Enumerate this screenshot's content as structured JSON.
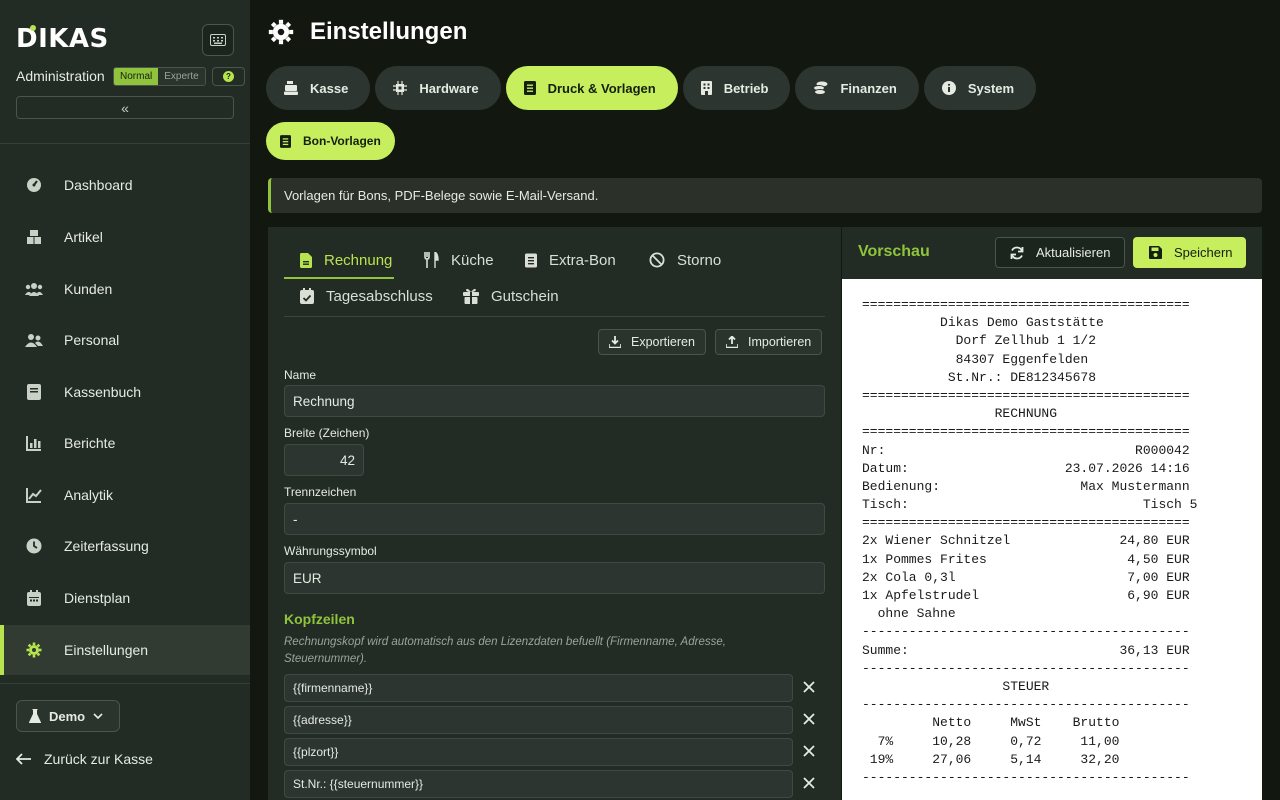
{
  "sidebar": {
    "logo": "DIKAS",
    "admin_label": "Administration",
    "mode_normal": "Normal",
    "mode_expert": "Experte",
    "help": "?",
    "collapse": "«",
    "nav": [
      {
        "label": "Dashboard",
        "icon": "gauge-icon"
      },
      {
        "label": "Artikel",
        "icon": "boxes-icon"
      },
      {
        "label": "Kunden",
        "icon": "users-icon"
      },
      {
        "label": "Personal",
        "icon": "user-group-icon"
      },
      {
        "label": "Kassenbuch",
        "icon": "book-icon"
      },
      {
        "label": "Berichte",
        "icon": "bar-chart-icon"
      },
      {
        "label": "Analytik",
        "icon": "line-chart-icon"
      },
      {
        "label": "Zeiterfassung",
        "icon": "clock-icon"
      },
      {
        "label": "Dienstplan",
        "icon": "calendar-icon"
      },
      {
        "label": "Einstellungen",
        "icon": "gear-icon"
      }
    ],
    "demo_label": "Demo",
    "back_label": "Zurück zur Kasse"
  },
  "header": {
    "title": "Einstellungen",
    "tabs": [
      {
        "label": "Kasse"
      },
      {
        "label": "Hardware"
      },
      {
        "label": "Druck & Vorlagen"
      },
      {
        "label": "Betrieb"
      },
      {
        "label": "Finanzen"
      },
      {
        "label": "System"
      }
    ],
    "subtab": "Bon-Vorlagen",
    "info": "Vorlagen für Bons, PDF-Belege sowie E-Mail-Versand."
  },
  "editor": {
    "template_tabs": [
      "Rechnung",
      "Küche",
      "Extra-Bon",
      "Storno",
      "Tagesabschluss",
      "Gutschein"
    ],
    "export_label": "Exportieren",
    "import_label": "Importieren",
    "name_label": "Name",
    "name_value": "Rechnung",
    "width_label": "Breite (Zeichen)",
    "width_value": "42",
    "separator_label": "Trennzeichen",
    "separator_value": "-",
    "currency_label": "Währungssymbol",
    "currency_value": "EUR",
    "header_section": "Kopfzeilen",
    "header_hint": "Rechnungskopf wird automatisch aus den Lizenzdaten befuellt (Firmenname, Adresse, Steuernummer).",
    "header_lines": [
      "{{firmenname}}",
      "{{adresse}}",
      "{{plzort}}",
      "St.Nr.: {{steuernummer}}"
    ]
  },
  "preview": {
    "title": "Vorschau",
    "refresh_label": "Aktualisieren",
    "save_label": "Speichern",
    "receipt_lines": [
      "==========================================",
      "          Dikas Demo Gaststätte",
      "            Dorf Zellhub 1 1/2",
      "            84307 Eggenfelden",
      "           St.Nr.: DE812345678",
      "==========================================",
      "                 RECHNUNG",
      "==========================================",
      "Nr:                                R000042",
      "Datum:                    23.07.2026 14:16",
      "Bedienung:                  Max Mustermann",
      "Tisch:                              Tisch 5",
      "==========================================",
      "2x Wiener Schnitzel              24,80 EUR",
      "1x Pommes Frites                  4,50 EUR",
      "2x Cola 0,3l                      7,00 EUR",
      "1x Apfelstrudel                   6,90 EUR",
      "  ohne Sahne",
      "------------------------------------------",
      "Summe:                           36,13 EUR",
      "------------------------------------------",
      "                  STEUER",
      "------------------------------------------",
      "         Netto     MwSt    Brutto",
      "  7%     10,28     0,72     11,00",
      " 19%     27,06     5,14     32,20",
      "------------------------------------------"
    ]
  },
  "colors": {
    "accent": "#c6ee5d",
    "accent_dark": "#8fc43c",
    "sidebar": "#222b24",
    "background": "#12170f"
  }
}
